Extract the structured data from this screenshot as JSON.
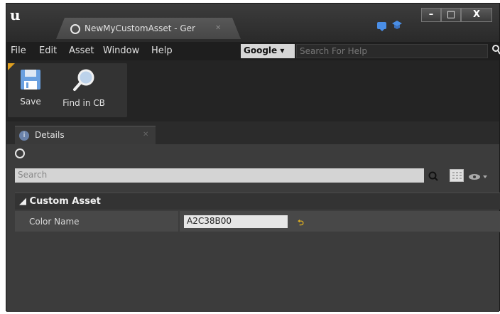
{
  "window": {
    "tab_title": "NewMyCustomAsset - Ger",
    "controls": {
      "minimize": "–",
      "maximize": "□",
      "close": "X"
    }
  },
  "menu": {
    "items": [
      "File",
      "Edit",
      "Asset",
      "Window",
      "Help"
    ],
    "google_label": "Google",
    "help_search_placeholder": "Search For Help"
  },
  "toolbar": {
    "save_label": "Save",
    "find_label": "Find in CB"
  },
  "details": {
    "tab_label": "Details",
    "search_placeholder": "Search",
    "category_label": "Custom Asset",
    "properties": [
      {
        "name": "Color Name",
        "value": "A2C38B00"
      }
    ]
  },
  "icons": {
    "app_logo": "unreal-engine-logo",
    "tab_icon": "circle-icon",
    "notify": "chat-icon",
    "learn": "graduation-cap-icon",
    "save": "floppy-disk-icon",
    "find": "magnifier-icon",
    "details": "info-icon",
    "reset": "reset-arrow-icon"
  },
  "colors": {
    "accent": "#e0a020",
    "icon_blue": "#4a8ee6"
  }
}
